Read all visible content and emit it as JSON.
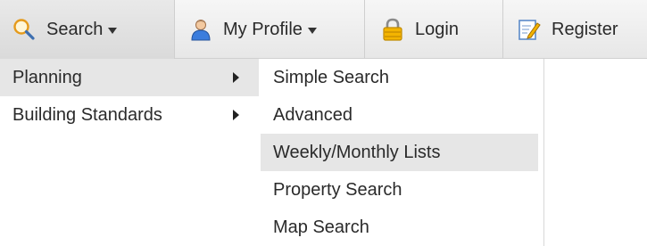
{
  "navbar": {
    "items": [
      {
        "label": "Search",
        "icon": "search-icon",
        "has_dropdown": true
      },
      {
        "label": "My Profile",
        "icon": "user-icon",
        "has_dropdown": true
      },
      {
        "label": "Login",
        "icon": "lock-icon",
        "has_dropdown": false
      },
      {
        "label": "Register",
        "icon": "edit-icon",
        "has_dropdown": false
      }
    ]
  },
  "search_menu": {
    "items": [
      {
        "label": "Planning",
        "has_submenu": true,
        "highlighted": true
      },
      {
        "label": "Building Standards",
        "has_submenu": true,
        "highlighted": false
      }
    ]
  },
  "planning_submenu": {
    "items": [
      {
        "label": "Simple Search"
      },
      {
        "label": "Advanced"
      },
      {
        "label": "Weekly/Monthly Lists",
        "highlighted": true
      },
      {
        "label": "Property Search"
      },
      {
        "label": "Map Search"
      }
    ]
  },
  "colors": {
    "icon_search": "#f0a020",
    "icon_user": "#3b7ddd",
    "icon_lock": "#f4b400",
    "icon_edit": "#5b8ac9",
    "highlight": "#e6e6e6"
  }
}
